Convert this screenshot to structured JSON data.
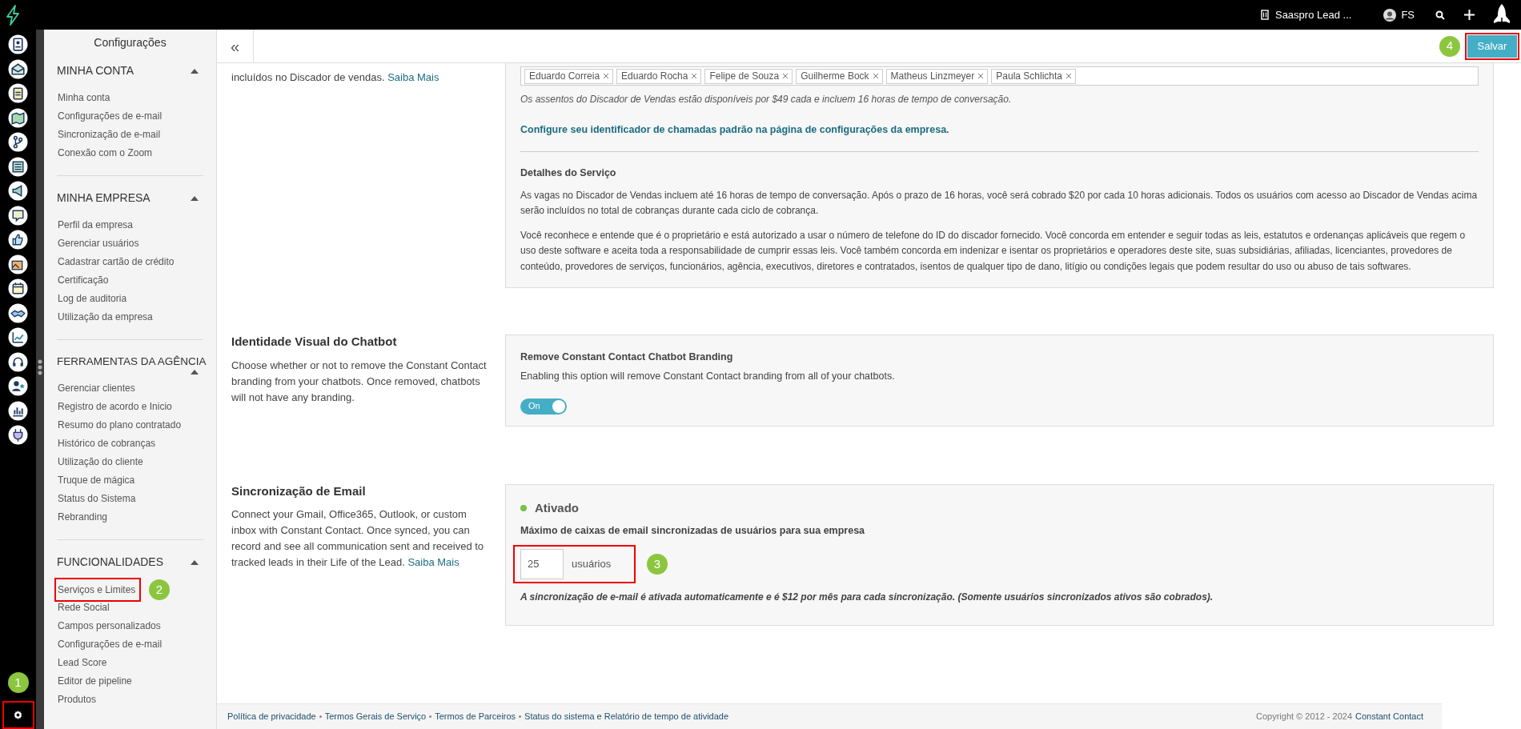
{
  "top_bar": {
    "company": "Saaspro Lead ...",
    "user": "FS",
    "settings_callout": "1"
  },
  "toolbar": {
    "collapse": "«",
    "save": "Salvar",
    "save_callout": "4"
  },
  "sidebar": {
    "title": "Configurações",
    "sections": [
      {
        "title": "MINHA CONTA",
        "expanded": true,
        "items": [
          {
            "label": "Minha conta"
          },
          {
            "label": "Configurações de e-mail"
          },
          {
            "label": "Sincronização de e-mail"
          },
          {
            "label": "Conexão com o Zoom"
          }
        ]
      },
      {
        "title": "MINHA EMPRESA",
        "expanded": true,
        "items": [
          {
            "label": "Perfil da empresa"
          },
          {
            "label": "Gerenciar usuários"
          },
          {
            "label": "Cadastrar cartão de crédito"
          },
          {
            "label": "Certificação"
          },
          {
            "label": "Log de auditoria"
          },
          {
            "label": "Utilização da empresa"
          }
        ]
      },
      {
        "title": "FERRAMENTAS DA AGÊNCIA",
        "expanded": true,
        "items": [
          {
            "label": "Gerenciar clientes"
          },
          {
            "label": "Registro de acordo e Inicio"
          },
          {
            "label": "Resumo do plano contratado"
          },
          {
            "label": "Histórico de cobranças"
          },
          {
            "label": "Utilização do cliente"
          },
          {
            "label": "Truque de mágica"
          },
          {
            "label": "Status do Sistema"
          },
          {
            "label": "Rebranding"
          }
        ]
      },
      {
        "title": "FUNCIONALIDADES",
        "expanded": true,
        "items": [
          {
            "label": "Serviços e Limites",
            "callout": "2"
          },
          {
            "label": "Rede Social"
          },
          {
            "label": "Campos personalizados"
          },
          {
            "label": "Configurações de e-mail"
          },
          {
            "label": "Lead Score"
          },
          {
            "label": "Editor de pipeline"
          },
          {
            "label": "Produtos"
          }
        ]
      }
    ]
  },
  "dialer": {
    "intro": "incluídos no Discador de vendas.",
    "link": "Saiba Mais",
    "users": [
      "Eduardo Correia",
      "Eduardo Rocha",
      "Felipe de Souza",
      "Guilherme Bock",
      "Matheus Linzmeyer",
      "Paula Schlichta"
    ],
    "note": "Os assentos do Discador de Vendas estão disponíveis por $49 cada e incluem 16 horas de tempo de conversação.",
    "config_link": "Configure seu identificador de chamadas padrão na página de configurações da empresa.",
    "details_title": "Detalhes do Serviço",
    "paragraphs": [
      "As vagas no Discador de Vendas incluem até 16 horas de tempo de conversação. Após o prazo de 16 horas, você será cobrado $20 por cada 10 horas adicionais. Todos os usuários com acesso ao Discador de Vendas acima serão incluídos no total de cobranças durante cada ciclo de cobrança.",
      "Você reconhece e entende que é o proprietário e está autorizado a usar o número de telefone do ID do discador fornecido. Você concorda em entender e seguir todas as leis, estatutos e ordenanças aplicáveis que regem o uso deste software e aceita toda a responsabilidade de cumprir essas leis. Você também concorda em indenizar e isentar os proprietários e operadores deste site, suas subsidiárias, afiliadas, licenciantes, provedores de conteúdo, provedores de serviços, funcionários, agência, executivos, diretores e contratados, isentos de qualquer tipo de dano, litígio ou condições legais que podem resultar do uso ou abuso de tais softwares."
    ]
  },
  "chatbot": {
    "title": "Identidade Visual do Chatbot",
    "description": "Choose whether or not to remove the Constant Contact branding from your chatbots. Once removed, chatbots will not have any branding.",
    "option_title": "Remove Constant Contact Chatbot Branding",
    "option_description": "Enabling this option will remove Constant Contact branding from all of your chatbots.",
    "toggle": {
      "label": "On",
      "on": true
    }
  },
  "email_sync": {
    "title": "Sincronização de Email",
    "description": "Connect your Gmail, Office365, Outlook, or custom inbox with Constant Contact. Once synced, you can record and see all communication sent and received to tracked leads in their Life of the Lead.",
    "link": "Saiba Mais",
    "status": "Ativado",
    "active": true,
    "max_label": "Máximo de caixas de email sincronizadas de usuários para sua empresa",
    "input": {
      "value": "25",
      "callout": "3"
    },
    "unit": "usuários",
    "note": "A sincronização de e-mail é ativada automaticamente e é $12 por mês para cada sincronização. (Somente usuários sincronizados ativos são cobrados)."
  },
  "footer": {
    "links": [
      "Política de privacidade",
      "Termos Gerais de Serviço",
      "Termos de Parceiros",
      "Status do sistema e Relatório de tempo de atividade"
    ],
    "copyright": "Copyright © 2012 - 2024",
    "brand": "Constant Contact"
  }
}
